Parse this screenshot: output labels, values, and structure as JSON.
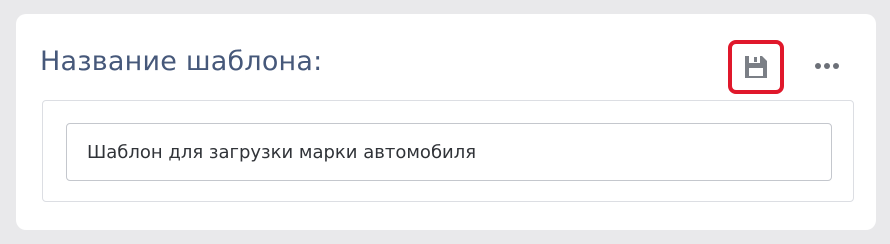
{
  "panel": {
    "title": "Название шаблона:"
  },
  "toolbar": {
    "save_icon": "floppy-disk-icon",
    "more_icon": "ellipsis-icon"
  },
  "template_name": {
    "value": "Шаблон для загрузки марки автомобиля"
  },
  "colors": {
    "title": "#46587a",
    "highlight_border": "#e0182b",
    "icon": "#7b7f86"
  }
}
